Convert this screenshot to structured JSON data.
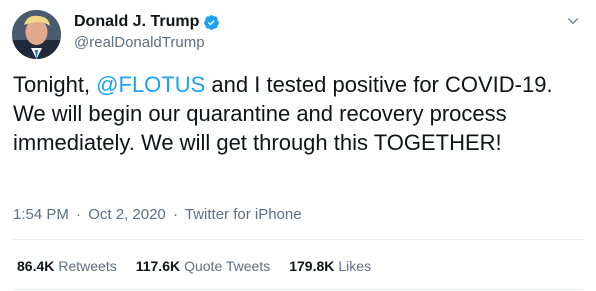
{
  "author": {
    "display_name": "Donald J. Trump",
    "handle": "@realDonaldTrump",
    "verified": true
  },
  "tweet": {
    "text_before": "Tonight, ",
    "mention": "@FLOTUS",
    "text_after": " and I tested positive for COVID-19. We will begin our quarantine and recovery process immediately. We will get through this TOGETHER!"
  },
  "meta": {
    "time": "1:54 PM",
    "separator": "·",
    "date": "Oct 2, 2020",
    "source": "Twitter for iPhone"
  },
  "stats": {
    "retweets_count": "86.4K",
    "retweets_label": "Retweets",
    "quote_tweets_count": "117.6K",
    "quote_tweets_label": "Quote Tweets",
    "likes_count": "179.8K",
    "likes_label": "Likes"
  },
  "colors": {
    "accent": "#1da1f2",
    "secondary_text": "#5b7083",
    "divider": "#e6ecf0"
  },
  "icons": {
    "verified": "verified-badge-icon",
    "more": "chevron-down-icon"
  }
}
